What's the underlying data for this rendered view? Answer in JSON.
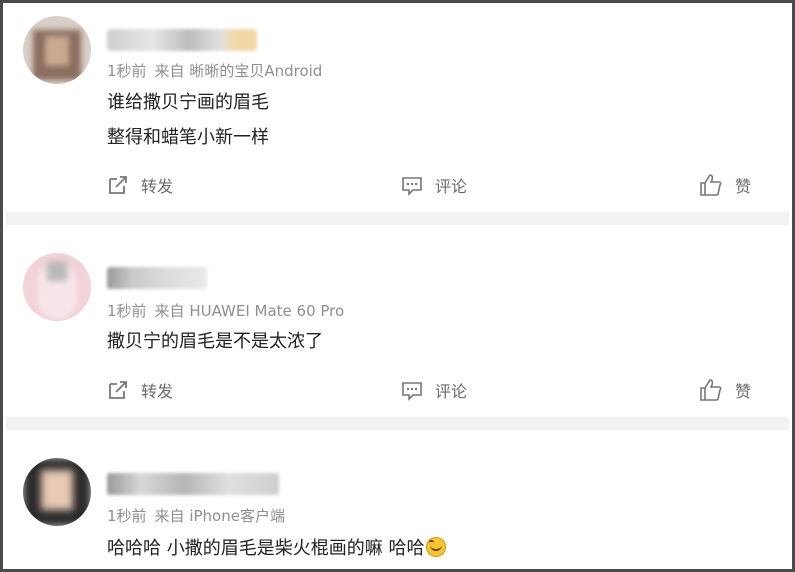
{
  "posts": [
    {
      "time": "1秒前",
      "source": "来自 晰晰的宝贝Android",
      "lines": [
        "谁给撒贝宁画的眉毛",
        "整得和蜡笔小新一样"
      ],
      "actions": {
        "repost": "转发",
        "comment": "评论",
        "like": "赞"
      }
    },
    {
      "time": "1秒前",
      "source": "来自 HUAWEI Mate 60 Pro",
      "lines": [
        "撒贝宁的眉毛是不是太浓了"
      ],
      "actions": {
        "repost": "转发",
        "comment": "评论",
        "like": "赞"
      }
    },
    {
      "time": "1秒前",
      "source": "来自 iPhone客户端",
      "lines": [
        "哈哈哈 小撒的眉毛是柴火棍画的嘛 哈哈"
      ],
      "emoji": "laughing-emoji"
    }
  ],
  "colors": {
    "meta": "#8f8f8f",
    "text": "#222222",
    "separator": "#f2f2f2",
    "border": "#4a4a4a"
  }
}
